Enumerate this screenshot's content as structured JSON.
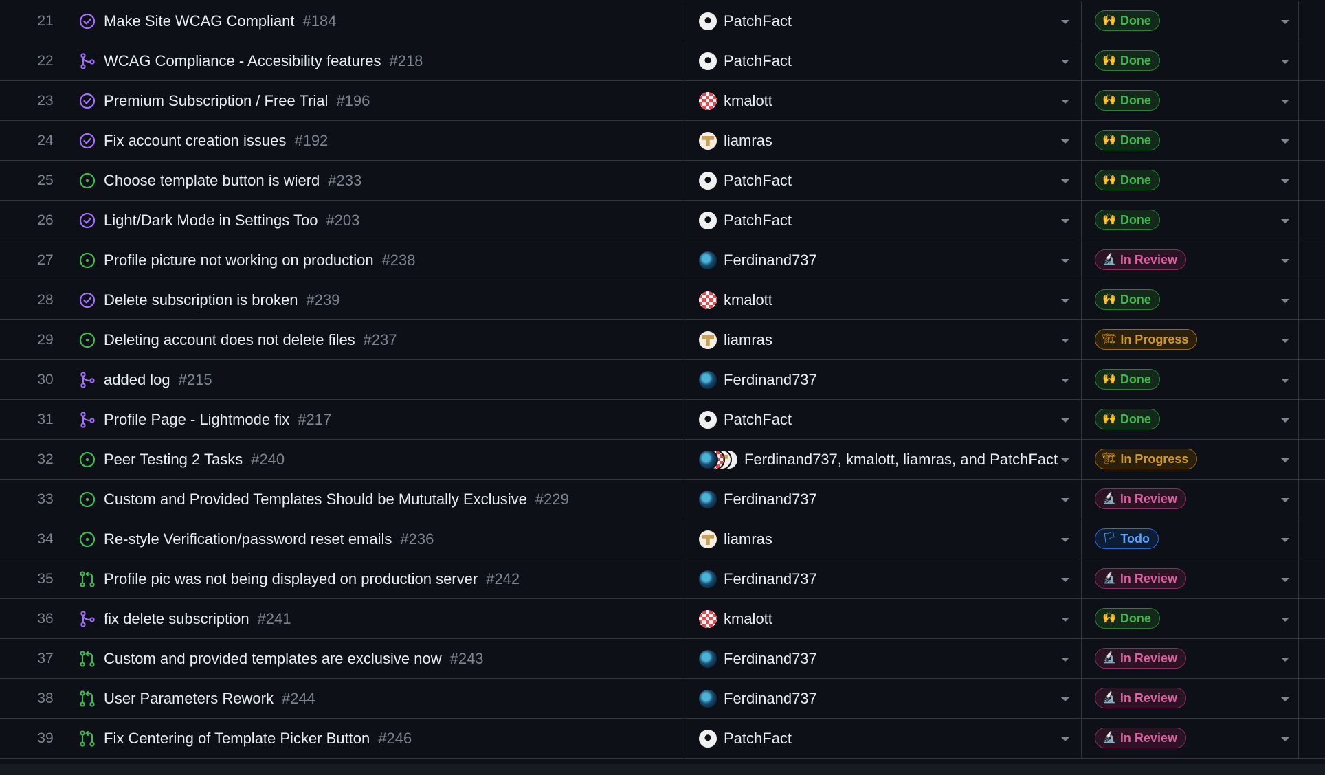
{
  "colors": {
    "background": "#0d1117",
    "border": "#30363d",
    "muted_text": "#7d8590",
    "done": "#3fb950",
    "in_review": "#db61a2",
    "in_progress": "#d29922",
    "todo": "#58a6ff",
    "open_icon": "#3fb950",
    "closed_icon": "#a371f7"
  },
  "statuses": {
    "done": {
      "label": "Done",
      "emoji": "🙌",
      "icon": "raised-hands-icon"
    },
    "review": {
      "label": "In Review",
      "emoji": "🔬",
      "icon": "microscope-icon"
    },
    "progress": {
      "label": "In Progress",
      "emoji": "🏗",
      "icon": "construction-icon"
    },
    "todo": {
      "label": "Todo",
      "emoji": "🏳",
      "icon": "white-flag-icon"
    }
  },
  "rows": [
    {
      "num": "21",
      "type": "issue-closed",
      "title": "Make Site WCAG Compliant",
      "ref": "#184",
      "assignees": [
        "patch"
      ],
      "assignee_text": "PatchFact",
      "status": "done"
    },
    {
      "num": "22",
      "type": "pr-merged",
      "title": "WCAG Compliance - Accesibility features",
      "ref": "#218",
      "assignees": [
        "patch"
      ],
      "assignee_text": "PatchFact",
      "status": "done"
    },
    {
      "num": "23",
      "type": "issue-closed",
      "title": "Premium Subscription / Free Trial",
      "ref": "#196",
      "assignees": [
        "kmal"
      ],
      "assignee_text": "kmalott",
      "status": "done"
    },
    {
      "num": "24",
      "type": "issue-closed",
      "title": "Fix account creation issues",
      "ref": "#192",
      "assignees": [
        "liam"
      ],
      "assignee_text": "liamras",
      "status": "done"
    },
    {
      "num": "25",
      "type": "issue-open",
      "title": "Choose template button is wierd",
      "ref": "#233",
      "assignees": [
        "patch"
      ],
      "assignee_text": "PatchFact",
      "status": "done"
    },
    {
      "num": "26",
      "type": "issue-closed",
      "title": "Light/Dark Mode in Settings Too",
      "ref": "#203",
      "assignees": [
        "patch"
      ],
      "assignee_text": "PatchFact",
      "status": "done"
    },
    {
      "num": "27",
      "type": "issue-open",
      "title": "Profile picture not working on production",
      "ref": "#238",
      "assignees": [
        "ferd"
      ],
      "assignee_text": "Ferdinand737",
      "status": "review"
    },
    {
      "num": "28",
      "type": "issue-closed",
      "title": "Delete subscription is broken",
      "ref": "#239",
      "assignees": [
        "kmal"
      ],
      "assignee_text": "kmalott",
      "status": "done"
    },
    {
      "num": "29",
      "type": "issue-open",
      "title": "Deleting account does not delete files",
      "ref": "#237",
      "assignees": [
        "liam"
      ],
      "assignee_text": "liamras",
      "status": "progress"
    },
    {
      "num": "30",
      "type": "pr-merged",
      "title": "added log",
      "ref": "#215",
      "assignees": [
        "ferd"
      ],
      "assignee_text": "Ferdinand737",
      "status": "done"
    },
    {
      "num": "31",
      "type": "pr-merged",
      "title": "Profile Page - Lightmode fix",
      "ref": "#217",
      "assignees": [
        "patch"
      ],
      "assignee_text": "PatchFact",
      "status": "done"
    },
    {
      "num": "32",
      "type": "issue-open",
      "title": "Peer Testing 2 Tasks",
      "ref": "#240",
      "assignees": [
        "ferd",
        "kmal",
        "liam",
        "patch"
      ],
      "assignee_text": "Ferdinand737, kmalott, liamras, and PatchFact",
      "status": "progress"
    },
    {
      "num": "33",
      "type": "issue-open",
      "title": "Custom and Provided Templates Should be Mututally Exclusive",
      "ref": "#229",
      "assignees": [
        "ferd"
      ],
      "assignee_text": "Ferdinand737",
      "status": "review"
    },
    {
      "num": "34",
      "type": "issue-open",
      "title": "Re-style Verification/password reset emails",
      "ref": "#236",
      "assignees": [
        "liam"
      ],
      "assignee_text": "liamras",
      "status": "todo"
    },
    {
      "num": "35",
      "type": "pr-open",
      "title": "Profile pic was not being displayed on production server",
      "ref": "#242",
      "assignees": [
        "ferd"
      ],
      "assignee_text": "Ferdinand737",
      "status": "review"
    },
    {
      "num": "36",
      "type": "pr-merged",
      "title": "fix delete subscription",
      "ref": "#241",
      "assignees": [
        "kmal"
      ],
      "assignee_text": "kmalott",
      "status": "done"
    },
    {
      "num": "37",
      "type": "pr-open",
      "title": "Custom and provided templates are exclusive now",
      "ref": "#243",
      "assignees": [
        "ferd"
      ],
      "assignee_text": "Ferdinand737",
      "status": "review"
    },
    {
      "num": "38",
      "type": "pr-open",
      "title": "User Parameters Rework",
      "ref": "#244",
      "assignees": [
        "ferd"
      ],
      "assignee_text": "Ferdinand737",
      "status": "review"
    },
    {
      "num": "39",
      "type": "pr-open",
      "title": "Fix Centering of Template Picker Button",
      "ref": "#246",
      "assignees": [
        "patch"
      ],
      "assignee_text": "PatchFact",
      "status": "review"
    }
  ]
}
